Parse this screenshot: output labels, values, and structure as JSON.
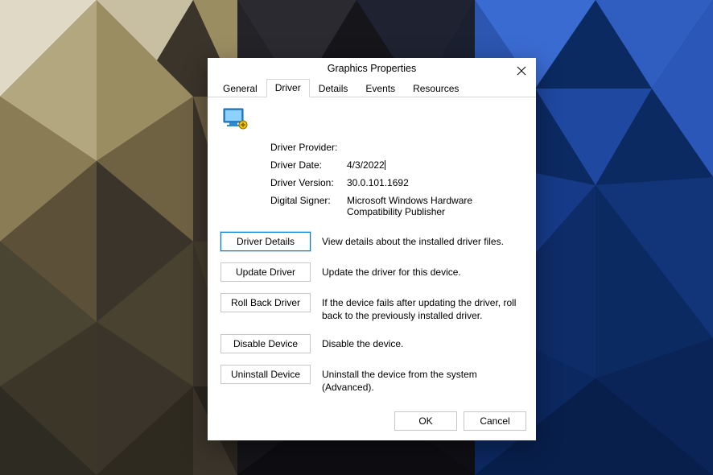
{
  "dialog": {
    "title": "Graphics Properties",
    "tabs": [
      "General",
      "Driver",
      "Details",
      "Events",
      "Resources"
    ],
    "selected_tab": "Driver"
  },
  "driver_info": {
    "provider_label": "Driver Provider:",
    "provider_value": "",
    "date_label": "Driver Date:",
    "date_value": "4/3/2022",
    "version_label": "Driver Version:",
    "version_value": "30.0.101.1692",
    "signer_label": "Digital Signer:",
    "signer_value": "Microsoft Windows Hardware Compatibility Publisher"
  },
  "actions": {
    "details": {
      "label": "Driver Details",
      "desc": "View details about the installed driver files."
    },
    "update": {
      "label": "Update Driver",
      "desc": "Update the driver for this device."
    },
    "rollback": {
      "label": "Roll Back Driver",
      "desc": "If the device fails after updating the driver, roll back to the previously installed driver."
    },
    "disable": {
      "label": "Disable Device",
      "desc": "Disable the device."
    },
    "uninstall": {
      "label": "Uninstall Device",
      "desc": "Uninstall the device from the system (Advanced)."
    }
  },
  "footer": {
    "ok": "OK",
    "cancel": "Cancel"
  }
}
